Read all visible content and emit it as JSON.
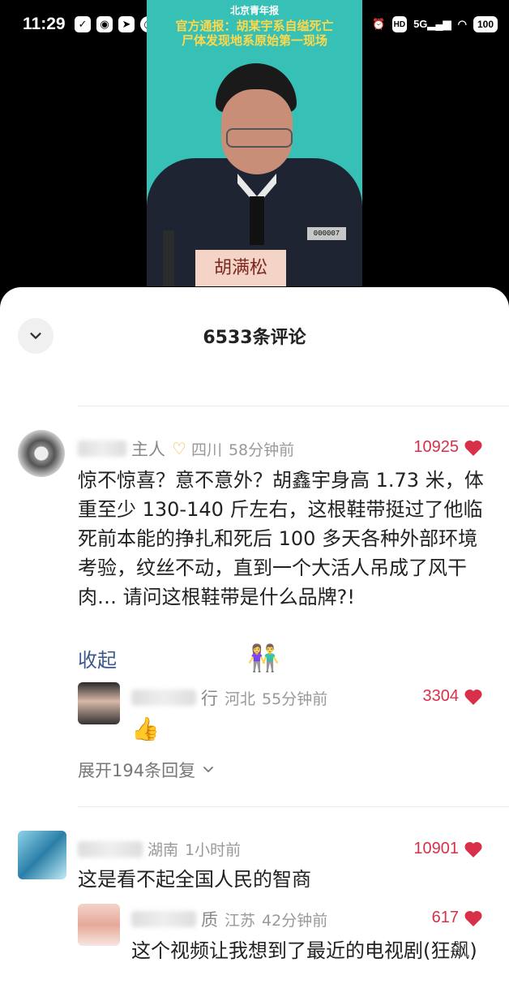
{
  "status": {
    "time": "11:29",
    "battery": "100",
    "network": "5G",
    "hd": "HD"
  },
  "video": {
    "logo": "北京青年报",
    "headline_line1": "官方通报：胡某宇系自缢死亡",
    "headline_line2": "尸体发现地系原始第一现场",
    "nameplate": "胡满松",
    "badge_number": "000007"
  },
  "sheet": {
    "title": "6533条评论"
  },
  "comments": [
    {
      "username_visible": "主人",
      "region": "四川",
      "time": "58分钟前",
      "likes": "10925",
      "text": "惊不惊喜？意不意外？胡鑫宇身高 1.73 米，体重至少 130-140 斤左右，这根鞋带挺过了他临死前本能的挣扎和死后 100 多天各种外部环境考验，纹丝不动，直到一个大活人吊成了风干肉… 请问这根鞋带是什么品牌?!",
      "collapse_label": "收起",
      "reply": {
        "username_visible": "行",
        "region": "河北",
        "time": "55分钟前",
        "likes": "3304",
        "emoji": "👍"
      },
      "expand_label": "展开194条回复"
    },
    {
      "region": "湖南",
      "time": "1小时前",
      "likes": "10901",
      "text": "这是看不起全国人民的智商",
      "reply": {
        "username_visible": "质",
        "region": "江苏",
        "time": "42分钟前",
        "likes": "617",
        "text": "这个视频让我想到了最近的电视剧(狂飙)"
      }
    }
  ],
  "colors": {
    "accent_like": "#d9304a",
    "link": "#3e5a8a",
    "video_bg": "#37c0b6"
  }
}
